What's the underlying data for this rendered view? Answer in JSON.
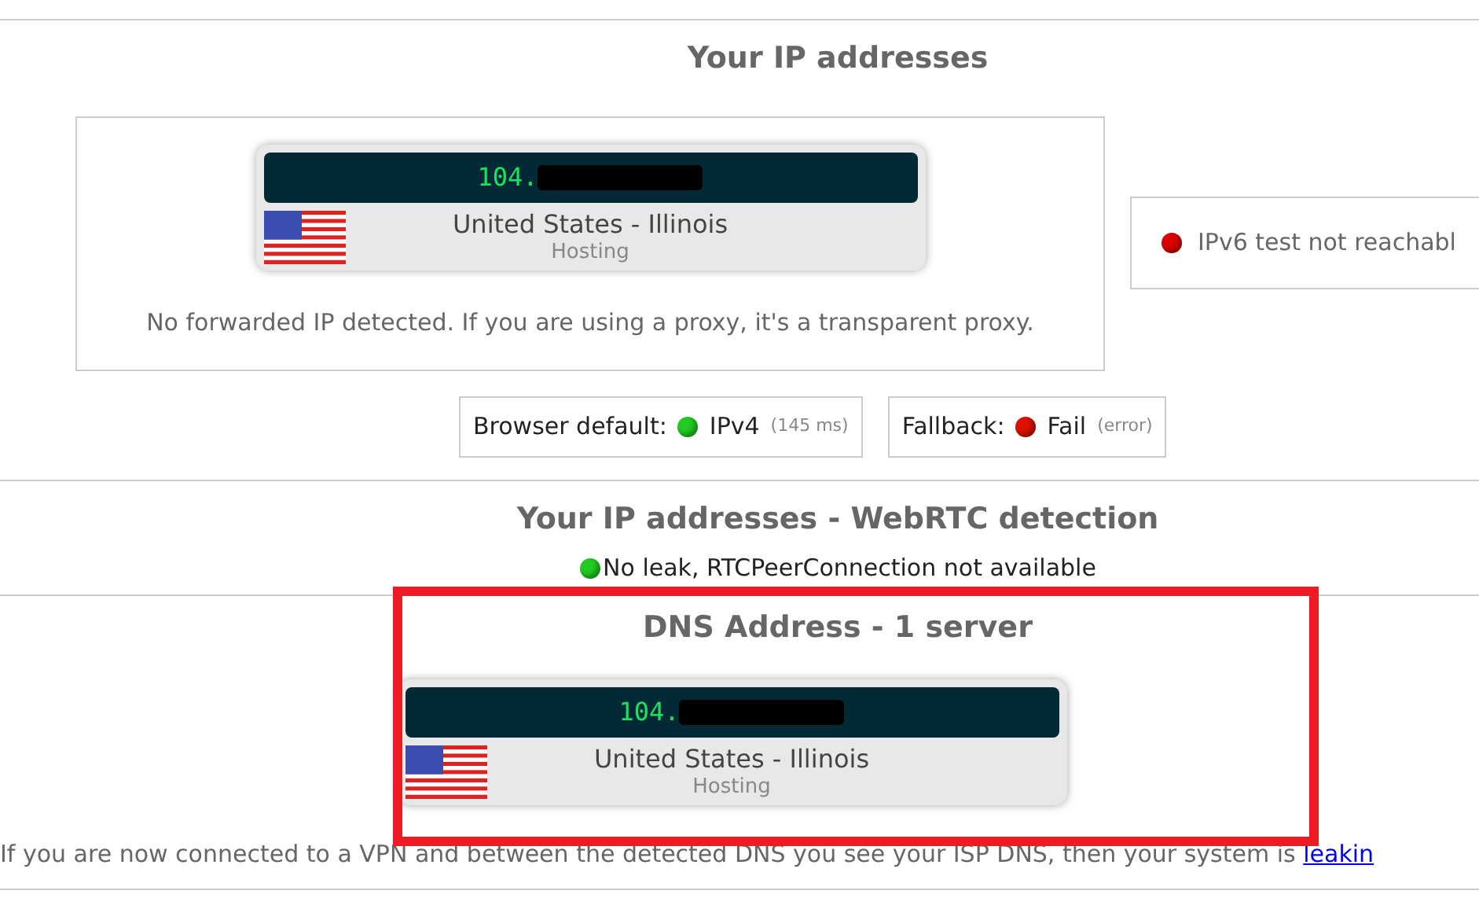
{
  "ip_section": {
    "title": "Your IP addresses",
    "ip_card": {
      "ip": "104.",
      "location": "United States - Illinois",
      "type": "Hosting"
    },
    "note": "No forwarded IP detected. If you are using a proxy, it's a transparent proxy.",
    "ipv6": {
      "color": "#dd0000",
      "text": "IPv6 test not reachabl"
    },
    "checks": [
      {
        "label": "Browser default:",
        "color": "#22cc22",
        "value": "IPv4",
        "detail": "(145 ms)"
      },
      {
        "label": "Fallback:",
        "color": "#dd1100",
        "value": "Fail",
        "detail": "(error)"
      }
    ]
  },
  "webrtc_section": {
    "title": "Your IP addresses - WebRTC detection",
    "status": {
      "color": "#22cc22",
      "text": "No leak, RTCPeerConnection not available"
    }
  },
  "dns_section": {
    "title": "DNS Address - 1 server",
    "servers": [
      {
        "ip": "104.",
        "location": "United States - Illinois",
        "type": "Hosting"
      }
    ],
    "note": "If you are now connected to a VPN and between the detected DNS you see your ISP DNS, then your system is ",
    "link": "leakin"
  }
}
